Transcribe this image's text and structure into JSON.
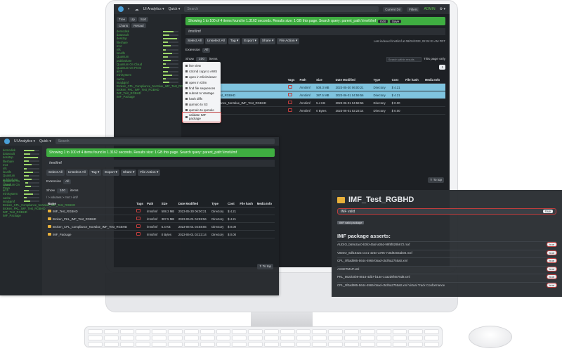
{
  "app": {
    "menu_analytics": "UI Analytics ▾",
    "menu_quick": "Quick ▾",
    "search_placeholder": "Search",
    "btn_current": "Current Dir",
    "btn_filters": "Filters",
    "online": "ADMIN",
    "user": "⚙ ▾"
  },
  "sidebar": {
    "tabs": [
      "Tree",
      "Up",
      "Sort"
    ],
    "tabs2": [
      "Charts",
      "Reload"
    ],
    "tree": [
      {
        "label": "demodisk",
        "fill": 0.7
      },
      {
        "label": "datavault",
        "fill": 0.4
      },
      {
        "label": "desktop",
        "fill": 0.9
      },
      {
        "label": "fileshare",
        "fill": 0.3
      },
      {
        "label": "mnt",
        "fill": 0.5
      },
      {
        "label": "nfs",
        "fill": 0.2
      },
      {
        "label": "localfs",
        "fill": 0.6
      },
      {
        "label": "Quantum",
        "fill": 0.3
      },
      {
        "label": "publicshare",
        "fill": 0.5
      },
      {
        "label": "Quantum On Cloud",
        "fill": 0.2
      },
      {
        "label": "Quantum On Prem",
        "fill": 0.4
      },
      {
        "label": "arch",
        "fill": 0.3
      },
      {
        "label": "minisystem",
        "fill": 0.6
      },
      {
        "label": "cache",
        "fill": 0.2
      },
      {
        "label": "imadajmf",
        "fill": 0.4
      },
      {
        "label": "Broken_CPL_Compliance_NoValue_IMF_Test_RGBHD",
        "fill": 0.0
      },
      {
        "label": "Broken_PKL_IMF_Test_RGBHD",
        "fill": 0.0
      },
      {
        "label": "IMF_Test_RGBHD",
        "fill": 0.0
      },
      {
        "label": "IMF_Package",
        "fill": 0.0
      }
    ]
  },
  "main": {
    "alert_text": "Showing 1 to 100 of 4 items found in 1.3162 seconds. Results size: 1 GB this page. Search query: parent_path:\\/mnt\\/imf",
    "alert_edit": "Edit",
    "alert_save": "Save",
    "breadcrumb": "/mnt/imf",
    "toolbar": [
      "Select All",
      "Unselect All",
      "Tag ▾",
      "Export ▾",
      "Share ▾",
      "File Action ▾"
    ],
    "last_index": "Last indexed /mnt/imf at 06/01/2023, 02:24:01 AM PDT",
    "extension_label": "Extension",
    "extension_chip": "All",
    "show_label": "Show",
    "show_value": "100",
    "show_items": "items",
    "search_results": "Search within results",
    "page_only": "This page only",
    "page_num": "1",
    "path_line": "/ > volumes > mnt > imf/",
    "columns": [
      "Name",
      "Tags",
      "Path",
      "Size",
      "Date Modified",
      "Type",
      "Cost",
      "File hash",
      "Media Info"
    ],
    "rows": [
      {
        "name": "IMF_Test_RGBHD",
        "path": "/mnt/imf",
        "size": "508.3 MB",
        "date": "2023-05-30 06:00:21",
        "type": "Directory",
        "cost": "$ 4.21"
      },
      {
        "name": "Broken_PKL_IMF_Test_RGBHD",
        "path": "/mnt/imf",
        "size": "387.5 MB",
        "date": "2023-06-01 04:59:56",
        "type": "Directory",
        "cost": "$ 4.21"
      },
      {
        "name": "Broken_CPL_Compliance_NoValue_IMF_Test_RGBHD",
        "path": "/mnt/imf",
        "size": "5.4 KB",
        "date": "2023-06-01 04:58:56",
        "type": "Directory",
        "cost": "$ 0.00"
      },
      {
        "name": "IMF_Package",
        "path": "/mnt/imf",
        "size": "0 Bytes",
        "date": "2023-06-01 02:23:14",
        "type": "Directory",
        "cost": "$ 0.00"
      }
    ],
    "to_top": "⇑ To top"
  },
  "file_action_menu": [
    "live view",
    "s3cmd copy to AWS",
    "open in ClickViewer",
    "open in Glim",
    "find file sequences",
    "submit to Vantage",
    "hash diffs",
    "qumulo to S3",
    "qumulo to qumulo",
    "validate IMF package"
  ],
  "imf_panel": {
    "title": "IMF_Test_RGBHD",
    "valid_label": "IMF valid",
    "valid_state": "true",
    "tag": "IMF valid package",
    "asserts_heading": "IMF package asserts:",
    "asserts": [
      {
        "text": "AUDIO_b60e2ac0-b0fd-45af-a05d-99f8f029b672.mxf",
        "state": "true"
      },
      {
        "text": "VIDEO_8df1842a-c4e1-425e-a795-7c8d9203ab04.mxf",
        "state": "true"
      },
      {
        "text": "CPL_0f0ad985-5644-4965-b5ad-c5cf6a2755a0.xml",
        "state": "true"
      },
      {
        "text": "ASSETMAP.xml",
        "state": "true"
      },
      {
        "text": "PKL_562dc0b9-8016-4db7-b14e-1ca2d9f4575d8.xml",
        "state": "true"
      },
      {
        "text": "CPL_0f0ad985-5644-4965-b5ad-c5cf6a2755a0.xml Virtual Track Conformance",
        "state": "true"
      }
    ]
  }
}
